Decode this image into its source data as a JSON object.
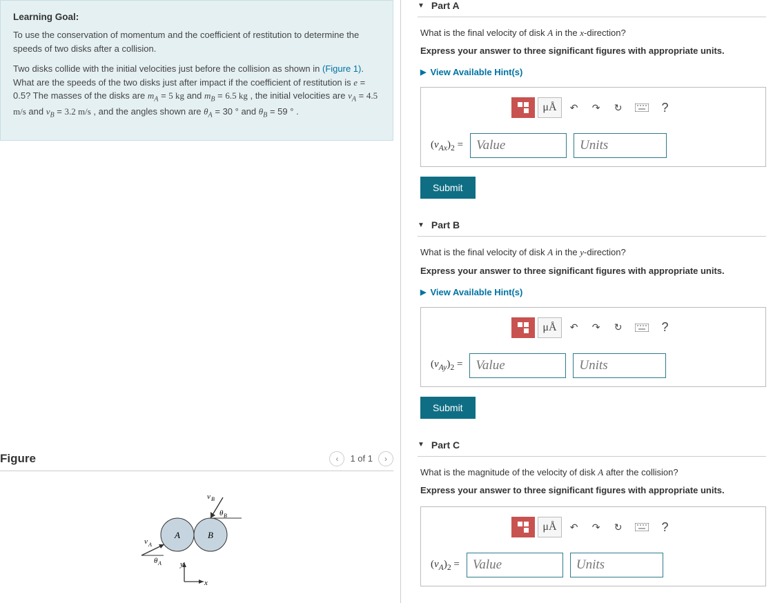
{
  "goal": {
    "heading": "Learning Goal:",
    "p1": "To use the conservation of momentum and the coefficient of restitution to determine the speeds of two disks after a collision.",
    "p2_pre": "Two disks collide with the initial velocities just before the collision as shown in ",
    "p2_link": "(Figure 1)",
    "p2_post": ". What are the speeds of the two disks just after impact if the coefficient of restitution is ",
    "values": {
      "e": "0.5",
      "mA": "5 kg",
      "mB": "6.5 kg",
      "vA": "4.5 m/s",
      "vB": "3.2 m/s",
      "thA": "30 °",
      "thB": "59 °"
    }
  },
  "figure": {
    "heading": "Figure",
    "counter": "1 of 1"
  },
  "toolbar": {
    "ua": "μÅ",
    "help": "?"
  },
  "submit": "Submit",
  "placeholders": {
    "value": "Value",
    "units": "Units"
  },
  "hints_label": "View Available Hint(s)",
  "parts": {
    "A": {
      "title": "Part A",
      "q_pre": "What is the final velocity of disk ",
      "q_mid": " in the ",
      "q_dir": "x",
      "q_post": "-direction?",
      "dir": "Express your answer to three significant figures with appropriate units.",
      "lhs_main": "v",
      "lhs_sub": "Ax",
      "lhs_post": ")",
      "lhs_pre": "(",
      "lhs_num": "2"
    },
    "B": {
      "title": "Part B",
      "q_pre": "What is the final velocity of disk ",
      "q_mid": " in the ",
      "q_dir": "y",
      "q_post": "-direction?",
      "dir": "Express your answer to three significant figures with appropriate units.",
      "lhs_sub": "Ay"
    },
    "C": {
      "title": "Part C",
      "q": "What is the magnitude of the velocity of disk ",
      "q_post": " after the collision?",
      "dir": "Express your answer to three significant figures with appropriate units.",
      "lhs_sub": "A"
    }
  }
}
